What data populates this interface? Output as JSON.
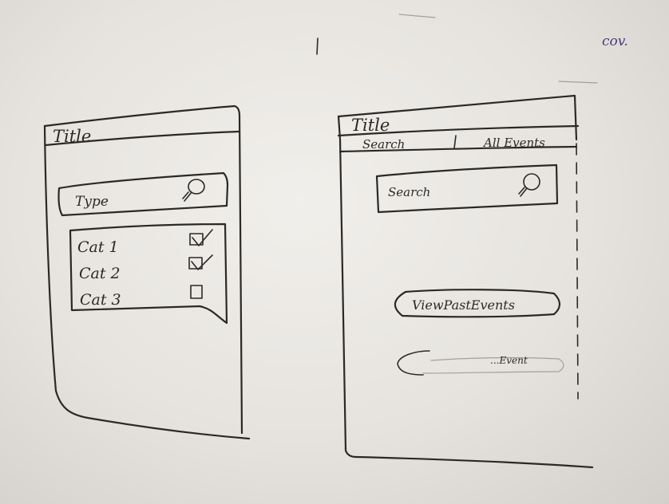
{
  "left_screen": {
    "title": "Title",
    "search_placeholder": "Type",
    "categories": [
      {
        "label": "Cat 1",
        "checked": true
      },
      {
        "label": "Cat 2",
        "checked": true
      },
      {
        "label": "Cat 3",
        "checked": false
      }
    ]
  },
  "right_screen": {
    "title": "Title",
    "tabs": [
      "Search",
      "All Events"
    ],
    "search_placeholder": "Search",
    "view_past_button": "ViewPastEvents",
    "faint_button": "...Event"
  },
  "board_marks": {
    "top_right_scribble": "cov."
  },
  "colors": {
    "ink": "#2b2826",
    "board": "#ece9e5",
    "marker_purple": "#4a3b78"
  }
}
